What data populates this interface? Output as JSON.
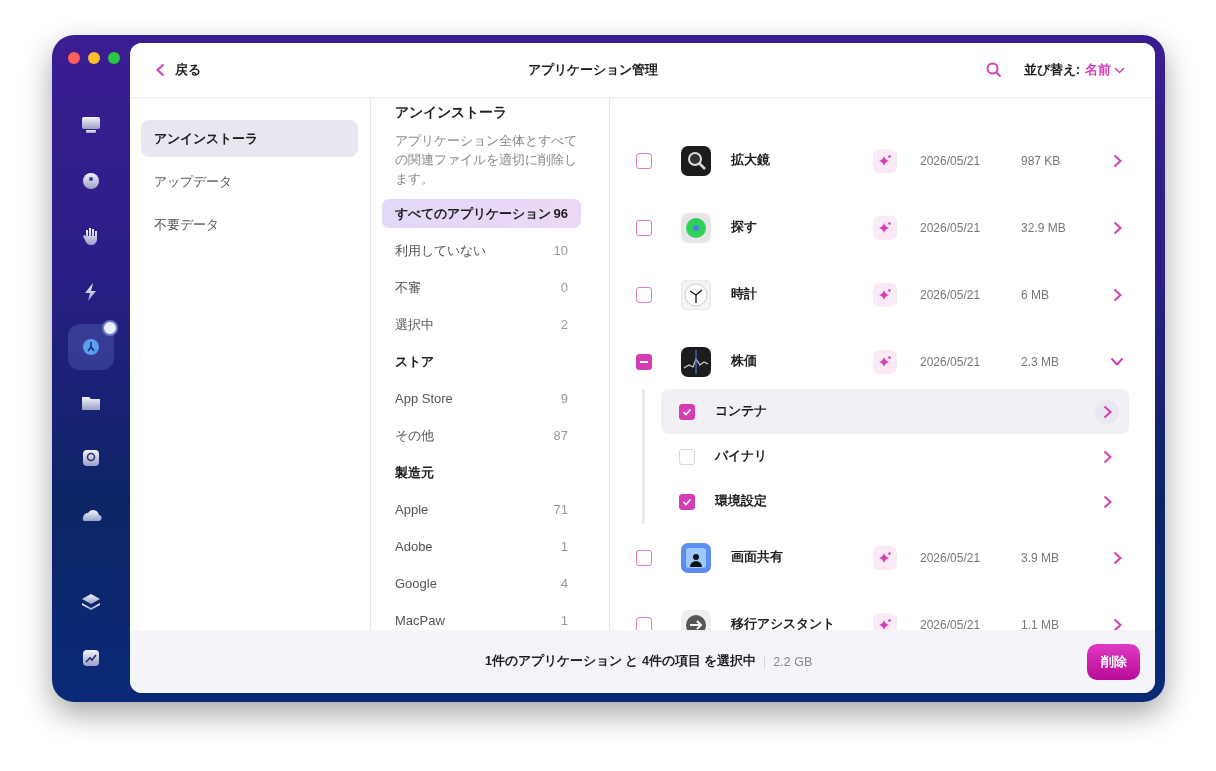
{
  "header": {
    "back": "戻る",
    "title": "アプリケーション管理",
    "sort_label": "並び替え:",
    "sort_value": "名前"
  },
  "sidebar": {
    "items": [
      {
        "kind": "monitor",
        "selected": false
      },
      {
        "kind": "globe",
        "selected": false
      },
      {
        "kind": "hand",
        "selected": false
      },
      {
        "kind": "bolt",
        "selected": false
      },
      {
        "kind": "apps",
        "selected": true
      },
      {
        "kind": "folder",
        "selected": false
      },
      {
        "kind": "search",
        "selected": false
      },
      {
        "kind": "cloud",
        "selected": false
      },
      {
        "kind": "layers",
        "selected": false
      },
      {
        "kind": "chart",
        "selected": false
      }
    ]
  },
  "nav": {
    "items": [
      {
        "label": "アンインストーラ",
        "selected": true
      },
      {
        "label": "アップデータ",
        "selected": false
      },
      {
        "label": "不要データ",
        "selected": false
      }
    ]
  },
  "filters": {
    "title": "アンインストーラ",
    "description": "アプリケーション全体とすべての関連ファイルを適切に削除します。",
    "items": [
      {
        "kind": "item",
        "label": "すべてのアプリケーション",
        "count": "96",
        "selected": true
      },
      {
        "kind": "item",
        "label": "利用していない",
        "count": "10",
        "selected": false
      },
      {
        "kind": "item",
        "label": "不審",
        "count": "0",
        "selected": false
      },
      {
        "kind": "item",
        "label": "選択中",
        "count": "2",
        "selected": false
      },
      {
        "kind": "heading",
        "label": "ストア"
      },
      {
        "kind": "item",
        "label": "App Store",
        "count": "9",
        "selected": false
      },
      {
        "kind": "item",
        "label": "その他",
        "count": "87",
        "selected": false
      },
      {
        "kind": "heading",
        "label": "製造元"
      },
      {
        "kind": "item",
        "label": "Apple",
        "count": "71",
        "selected": false
      },
      {
        "kind": "item",
        "label": "Adobe",
        "count": "1",
        "selected": false
      },
      {
        "kind": "item",
        "label": "Google",
        "count": "4",
        "selected": false
      },
      {
        "kind": "item",
        "label": "MacPaw",
        "count": "1",
        "selected": false
      }
    ]
  },
  "apps": [
    {
      "kind": "magnifier",
      "name": "拡大鏡",
      "date": "2026/05/21",
      "size": "987 KB",
      "checked": false,
      "partial": false,
      "expanded": false
    },
    {
      "kind": "findmy",
      "name": "探す",
      "date": "2026/05/21",
      "size": "32.9 MB",
      "checked": false,
      "partial": false,
      "expanded": false
    },
    {
      "kind": "clock",
      "name": "時計",
      "date": "2026/05/21",
      "size": "6 MB",
      "checked": false,
      "partial": false,
      "expanded": false
    },
    {
      "kind": "stocks",
      "name": "株価",
      "date": "2026/05/21",
      "size": "2.3 MB",
      "checked": false,
      "partial": true,
      "expanded": true,
      "children": [
        {
          "name": "コンテナ",
          "checked": true,
          "selected": true
        },
        {
          "name": "バイナリ",
          "checked": false,
          "selected": false
        },
        {
          "name": "環境設定",
          "checked": true,
          "selected": false
        }
      ]
    },
    {
      "kind": "screenshare",
      "name": "画面共有",
      "date": "2026/05/21",
      "size": "3.9 MB",
      "checked": false,
      "partial": false,
      "expanded": false
    },
    {
      "kind": "migration",
      "name": "移行アシスタント",
      "date": "2026/05/21",
      "size": "1.1 MB",
      "checked": false,
      "partial": false,
      "expanded": false
    }
  ],
  "footer": {
    "summary": "1件のアプリケーション と 4件の項目 を選択中",
    "size": "2.2 GB",
    "button": "削除"
  }
}
